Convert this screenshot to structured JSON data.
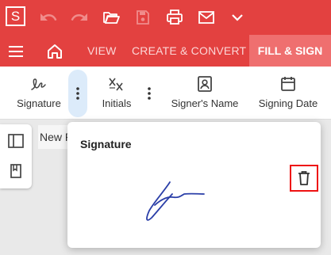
{
  "app": {
    "logo_letter": "S"
  },
  "toolbar": {
    "icons": [
      "undo-icon",
      "redo-icon",
      "folder-open-icon",
      "save-icon",
      "print-icon",
      "mail-icon",
      "chevron-down-icon"
    ]
  },
  "nav": {
    "tabs": [
      {
        "label": "VIEW"
      },
      {
        "label": "CREATE & CONVERT"
      },
      {
        "label": "FILL & SIGN",
        "active": true
      }
    ]
  },
  "ribbon": {
    "tools": [
      {
        "label": "Signature",
        "icon": "signature-icon"
      },
      {
        "label": "Initials",
        "icon": "initials-icon"
      },
      {
        "label": "Signer's Name",
        "icon": "signer-name-icon"
      },
      {
        "label": "Signing Date",
        "icon": "calendar-icon"
      }
    ]
  },
  "document": {
    "tab_label": "New P"
  },
  "popup": {
    "title": "Signature"
  },
  "colors": {
    "brand_red": "#e34140",
    "active_tab": "#ef6f6f",
    "ink_blue": "#2b3fa8",
    "highlight_red": "#e11111"
  }
}
